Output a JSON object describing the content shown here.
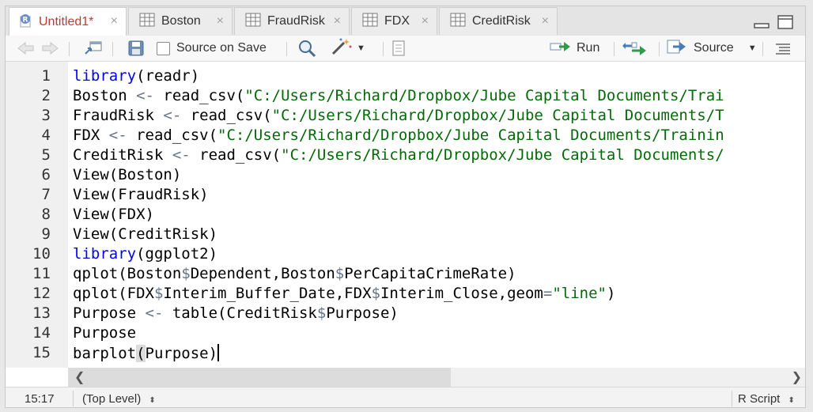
{
  "tabs": [
    {
      "label": "Untitled1*",
      "icon": "r-script-icon",
      "active": true
    },
    {
      "label": "Boston",
      "icon": "table-icon",
      "active": false
    },
    {
      "label": "FraudRisk",
      "icon": "table-icon",
      "active": false
    },
    {
      "label": "FDX",
      "icon": "table-icon",
      "active": false
    },
    {
      "label": "CreditRisk",
      "icon": "table-icon",
      "active": false
    }
  ],
  "tab_close": "×",
  "toolbar": {
    "source_on_save": "Source on Save",
    "run": "Run",
    "source": "Source"
  },
  "editor": {
    "lines": [
      {
        "num": "1",
        "tokens": [
          {
            "t": "library",
            "c": "kw"
          },
          {
            "t": "(readr)",
            "c": ""
          }
        ]
      },
      {
        "num": "2",
        "tokens": [
          {
            "t": "Boston ",
            "c": ""
          },
          {
            "t": "<-",
            "c": "op"
          },
          {
            "t": " read_csv(",
            "c": ""
          },
          {
            "t": "\"C:/Users/Richard/Dropbox/Jube Capital Documents/Trai",
            "c": "str"
          }
        ]
      },
      {
        "num": "3",
        "tokens": [
          {
            "t": "FraudRisk ",
            "c": ""
          },
          {
            "t": "<-",
            "c": "op"
          },
          {
            "t": " read_csv(",
            "c": ""
          },
          {
            "t": "\"C:/Users/Richard/Dropbox/Jube Capital Documents/T",
            "c": "str"
          }
        ]
      },
      {
        "num": "4",
        "tokens": [
          {
            "t": "FDX ",
            "c": ""
          },
          {
            "t": "<-",
            "c": "op"
          },
          {
            "t": " read_csv(",
            "c": ""
          },
          {
            "t": "\"C:/Users/Richard/Dropbox/Jube Capital Documents/Trainin",
            "c": "str"
          }
        ]
      },
      {
        "num": "5",
        "tokens": [
          {
            "t": "CreditRisk ",
            "c": ""
          },
          {
            "t": "<-",
            "c": "op"
          },
          {
            "t": " read_csv(",
            "c": ""
          },
          {
            "t": "\"C:/Users/Richard/Dropbox/Jube Capital Documents/",
            "c": "str"
          }
        ]
      },
      {
        "num": "6",
        "tokens": [
          {
            "t": "View(Boston)",
            "c": ""
          }
        ]
      },
      {
        "num": "7",
        "tokens": [
          {
            "t": "View(FraudRisk)",
            "c": ""
          }
        ]
      },
      {
        "num": "8",
        "tokens": [
          {
            "t": "View(FDX)",
            "c": ""
          }
        ]
      },
      {
        "num": "9",
        "tokens": [
          {
            "t": "View(CreditRisk)",
            "c": ""
          }
        ]
      },
      {
        "num": "10",
        "tokens": [
          {
            "t": "library",
            "c": "kw"
          },
          {
            "t": "(ggplot2)",
            "c": ""
          }
        ]
      },
      {
        "num": "11",
        "tokens": [
          {
            "t": "qplot(Boston",
            "c": ""
          },
          {
            "t": "$",
            "c": "dl"
          },
          {
            "t": "Dependent,Boston",
            "c": ""
          },
          {
            "t": "$",
            "c": "dl"
          },
          {
            "t": "PerCapitaCrimeRate)",
            "c": ""
          }
        ]
      },
      {
        "num": "12",
        "tokens": [
          {
            "t": "qplot(FDX",
            "c": ""
          },
          {
            "t": "$",
            "c": "dl"
          },
          {
            "t": "Interim_Buffer_Date,FDX",
            "c": ""
          },
          {
            "t": "$",
            "c": "dl"
          },
          {
            "t": "Interim_Close,geom",
            "c": ""
          },
          {
            "t": "=",
            "c": "op"
          },
          {
            "t": "\"line\"",
            "c": "str"
          },
          {
            "t": ")",
            "c": ""
          }
        ]
      },
      {
        "num": "13",
        "tokens": [
          {
            "t": "Purpose ",
            "c": ""
          },
          {
            "t": "<-",
            "c": "op"
          },
          {
            "t": " table(CreditRisk",
            "c": ""
          },
          {
            "t": "$",
            "c": "dl"
          },
          {
            "t": "Purpose)",
            "c": ""
          }
        ]
      },
      {
        "num": "14",
        "tokens": [
          {
            "t": "Purpose",
            "c": ""
          }
        ]
      },
      {
        "num": "15",
        "tokens": [
          {
            "t": "barplot",
            "c": ""
          },
          {
            "t": "(",
            "c": "pm"
          },
          {
            "t": "Purpose)",
            "c": ""
          }
        ],
        "cursor": true
      }
    ]
  },
  "status": {
    "position": "15:17",
    "scope": "(Top Level)",
    "file_type": "R Script"
  },
  "colors": {
    "keyword": "#0000ff",
    "string": "#036a07",
    "operator": "#687687",
    "active_tab_text": "#c0392b"
  }
}
